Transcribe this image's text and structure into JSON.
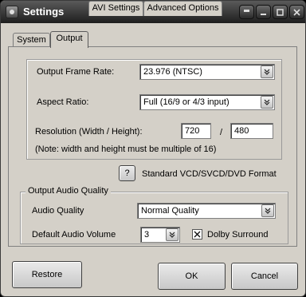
{
  "window": {
    "title": "Settings"
  },
  "titlebar_buttons": [
    "▫",
    "▬",
    "▭",
    "✕"
  ],
  "tabs": [
    {
      "label": "System",
      "active": false
    },
    {
      "label": "Output",
      "active": true
    },
    {
      "label": "AVI Settings",
      "active": false
    },
    {
      "label": "Advanced Options",
      "active": false
    }
  ],
  "output": {
    "frame_rate_label": "Output Frame Rate:",
    "frame_rate_value": "23.976  (NTSC)",
    "aspect_ratio_label": "Aspect Ratio:",
    "aspect_ratio_value": "Full (16/9 or 4/3 input)",
    "resolution_label": "Resolution (Width / Height):",
    "width_value": "720",
    "separator": "/",
    "height_value": "480",
    "note": "(Note: width and height must be multiple of 16)"
  },
  "format": {
    "help_button": "?",
    "label": "Standard VCD/SVCD/DVD Format"
  },
  "audio": {
    "group_title": "Output Audio Quality",
    "quality_label": "Audio Quality",
    "quality_value": "Normal Quality",
    "volume_label": "Default Audio Volume",
    "volume_value": "3",
    "dolby_label": "Dolby Surround",
    "dolby_checked": true
  },
  "buttons": {
    "restore": "Restore",
    "ok": "OK",
    "cancel": "Cancel"
  },
  "colors": {
    "titlebar": "#1e1e1e",
    "face": "#d4d0c8"
  }
}
